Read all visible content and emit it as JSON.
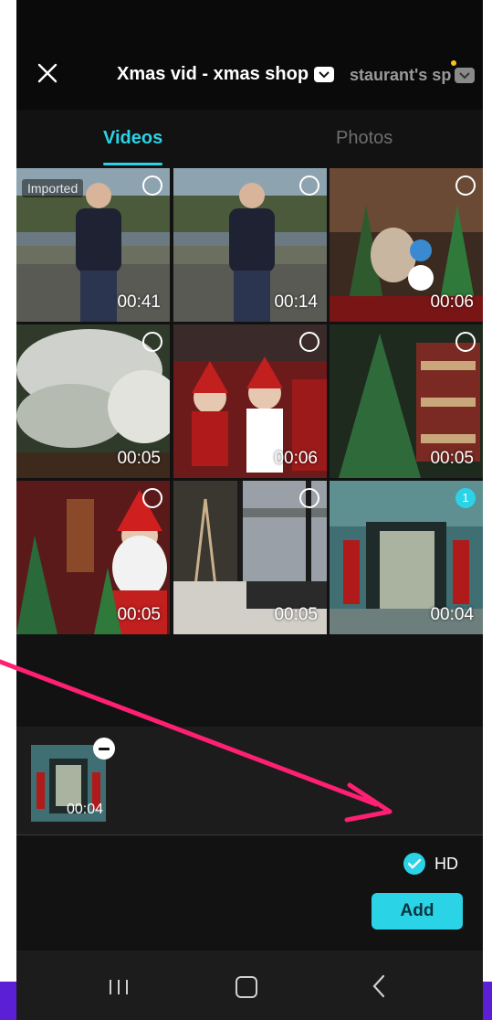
{
  "header": {
    "album_title": "Xmas vid - xmas shop",
    "next_album_title": "staurant's sp"
  },
  "tabs": [
    {
      "label": "Videos",
      "active": true
    },
    {
      "label": "Photos",
      "active": false
    }
  ],
  "grid": {
    "imported_badge": "Imported",
    "items": [
      {
        "duration": "00:41",
        "selected": false,
        "order": ""
      },
      {
        "duration": "00:14",
        "selected": false,
        "order": ""
      },
      {
        "duration": "00:06",
        "selected": false,
        "order": ""
      },
      {
        "duration": "00:05",
        "selected": false,
        "order": ""
      },
      {
        "duration": "00:06",
        "selected": false,
        "order": ""
      },
      {
        "duration": "00:05",
        "selected": false,
        "order": ""
      },
      {
        "duration": "00:05",
        "selected": false,
        "order": ""
      },
      {
        "duration": "00:05",
        "selected": false,
        "order": ""
      },
      {
        "duration": "00:04",
        "selected": true,
        "order": "1"
      }
    ]
  },
  "selected_tray": {
    "items": [
      {
        "duration": "00:04"
      }
    ]
  },
  "footer": {
    "hd_label": "HD",
    "hd_checked": true,
    "add_label": "Add"
  },
  "colors": {
    "accent": "#2ad3e6",
    "background": "#121212",
    "annotation_arrow": "#ff1f73",
    "outer_strip": "#5b1fd6"
  },
  "icons": [
    "close-icon",
    "chevron-down-icon",
    "remove-icon",
    "check-icon",
    "recent-apps-icon",
    "home-icon",
    "back-icon"
  ]
}
